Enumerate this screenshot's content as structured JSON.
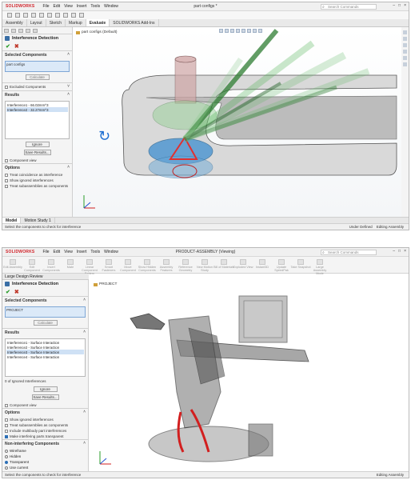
{
  "shot1": {
    "app_logo": "SOLIDWORKS",
    "menu": [
      "File",
      "Edit",
      "View",
      "Insert",
      "Tools",
      "Window"
    ],
    "title": "part configs *",
    "search_placeholder": "Search Commands",
    "tabs": [
      "Assembly",
      "Layout",
      "Sketch",
      "Markup",
      "Evaluate",
      "SOLIDWORKS Add-Ins"
    ],
    "active_tab": "Evaluate",
    "tree_item": "part configs (Default)",
    "pm": {
      "title": "Interference Detection",
      "selected_components_label": "Selected Components",
      "selected_component": "part configs",
      "calculate_label": "Calculate",
      "excluded_label": "Excluded Components",
      "results_label": "Results",
      "results": [
        "Interference1 - 66.02mm^3",
        "Interference2 - 32.27mm^3"
      ],
      "ignore_label": "Ignore",
      "save_results_label": "Save Results...",
      "component_view_label": "Component view",
      "options_label": "Options",
      "option_items": [
        "Treat coincidence as interference",
        "Show ignored interferences",
        "Treat subassemblies as components"
      ]
    },
    "bottom_tabs": [
      "Model",
      "Motion Study 1"
    ],
    "active_bottom_tab": "Model",
    "status_left": "Select the components to check for interference",
    "status_right": [
      "Under Defined",
      "Editing Assembly"
    ]
  },
  "shot2": {
    "app_logo": "SOLIDWORKS",
    "menu": [
      "File",
      "Edit",
      "View",
      "Insert",
      "Tools",
      "Window"
    ],
    "title": "PRODUCT-ASSEMBLY (Viewing)",
    "search_placeholder": "Search Commands",
    "large_design_review": "Large Design Review",
    "command_labels": [
      "Edit Assembly",
      "Edit Component",
      "Insert Components",
      "Mate",
      "Linear Component Pattern",
      "Smart Fasteners",
      "Move Component",
      "Show Hidden Components",
      "Assembly Features",
      "Reference Geometry",
      "New Motion Study",
      "Bill of Materials",
      "Exploded View",
      "Instant3D",
      "Update SpeedPak",
      "Take Snapshot",
      "Large Assembly Mode"
    ],
    "tree_item": "PROJECT",
    "pm": {
      "title": "Interference Detection",
      "selected_components_label": "Selected Components",
      "selected_component": "PROJECT",
      "calculate_label": "Calculate",
      "results_label": "Results",
      "results": [
        "Interference1 - Surface Interaction",
        "Interference2 - Surface Interaction",
        "Interference3 - Surface Interaction",
        "Interference4 - Surface Interaction"
      ],
      "ignored_label": "0 of Ignored Interferences",
      "ignore_label": "Ignore",
      "save_results_label": "Save Results...",
      "component_view_label": "Component view",
      "options_label": "Options",
      "option_items": [
        "Show ignored interferences",
        "Treat subassemblies as components",
        "Include multibody part interferences",
        "Make interfering parts transparent"
      ],
      "options_checked": [
        false,
        false,
        false,
        true
      ],
      "non_interfering_label": "Non-interfering Components",
      "non_interfering_items": [
        "Wireframe",
        "Hidden",
        "Transparent",
        "Use current"
      ],
      "non_interfering_selected": 2
    },
    "status_left": "Select the components to check for interference",
    "status_right": "Editing Assembly"
  }
}
